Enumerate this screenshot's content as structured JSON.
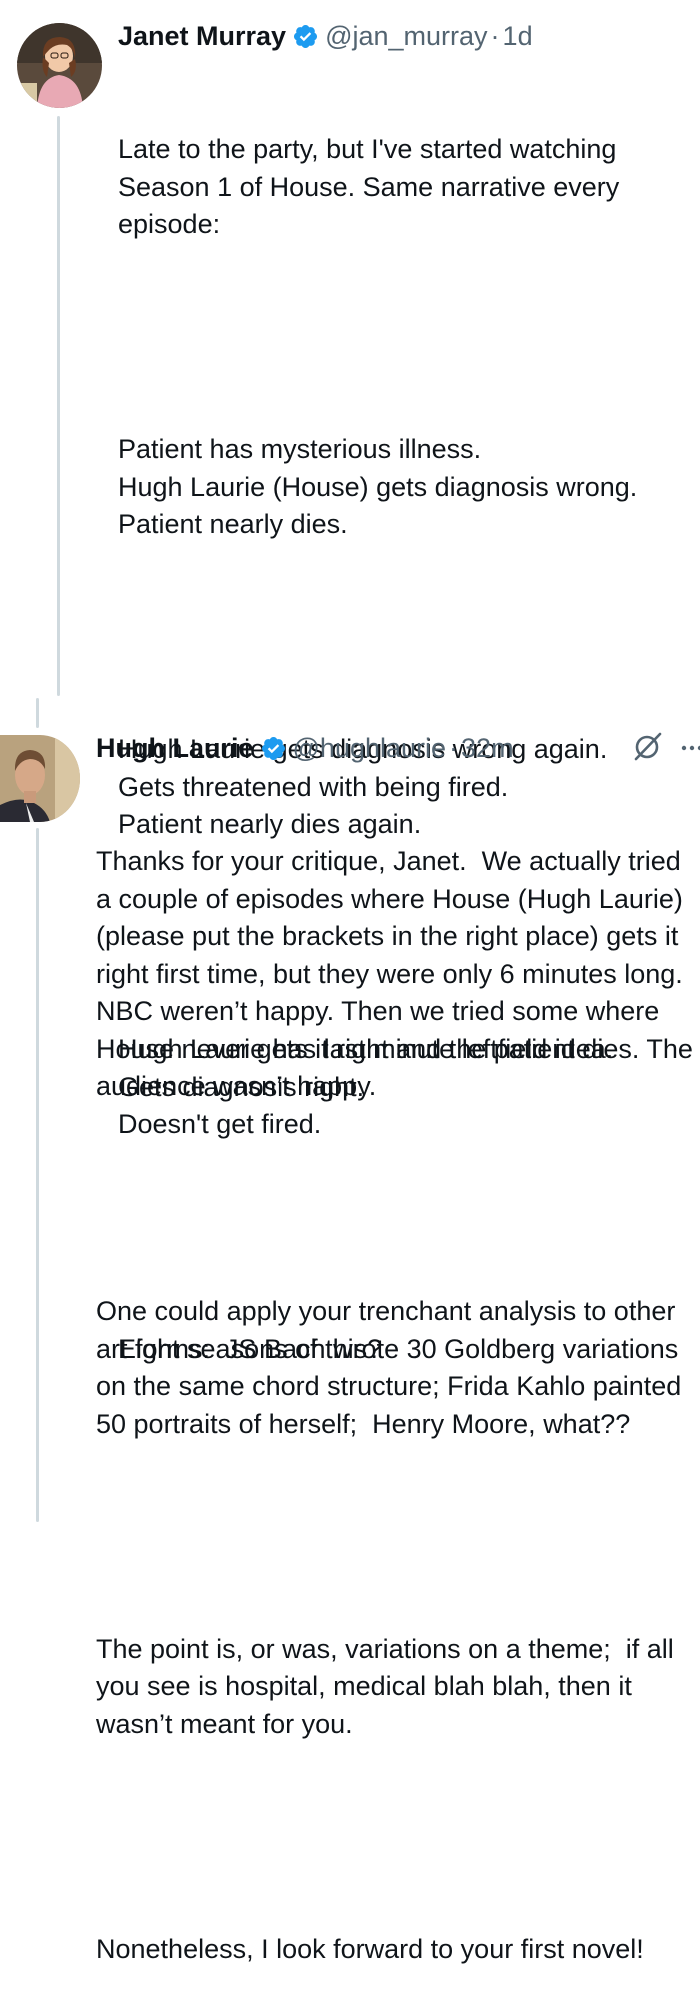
{
  "thread": {
    "tweets": [
      {
        "name": "Janet Murray",
        "handle": "@jan_murray",
        "separator": "·",
        "time": "1d",
        "paragraphs": [
          "Late to the party, but I've started watching Season 1 of House. Same narrative every episode:",
          "Patient has mysterious illness.\nHugh Laurie (House) gets diagnosis wrong.\nPatient nearly dies.",
          "Hugh Laurie gets diagnosis wrong again.\nGets threatened with being fired.\nPatient nearly dies again.",
          "Hugh Laurie has last minute leftfield idea.\nGets diagnosis right.\nDoesn't get fired.",
          "Eight seasons of this?"
        ]
      },
      {
        "name": "Hugh Laurie",
        "handle": "@hughlaurie",
        "separator": "·",
        "time": "32m",
        "paragraphs": [
          "Thanks for your critique, Janet.  We actually tried a couple of episodes where House (Hugh Laurie) (please put the brackets in the right place) gets it right first time, but they were only 6 minutes long.  NBC weren’t happy. Then we tried some where House never gets it right and the patient dies. The audience wasn’t happy.",
          "One could apply your trenchant analysis to other art forms:  JS Bach wrote 30 Goldberg variations on the same chord structure; Frida Kahlo painted 50 portraits of herself;  Henry Moore, what??",
          "The point is, or was, variations on a theme;  if all you see is hospital, medical blah blah, then it wasn’t meant for you.",
          "Nonetheless, I look forward to your first novel!"
        ]
      }
    ]
  },
  "colors": {
    "verified": "#1d9bf0",
    "muted": "#536471",
    "text": "#0f1419",
    "thread_line": "#cfd9de"
  },
  "icons": {
    "verified": "verified-badge-icon",
    "grok": "grok-icon",
    "more": "more-options-icon"
  }
}
